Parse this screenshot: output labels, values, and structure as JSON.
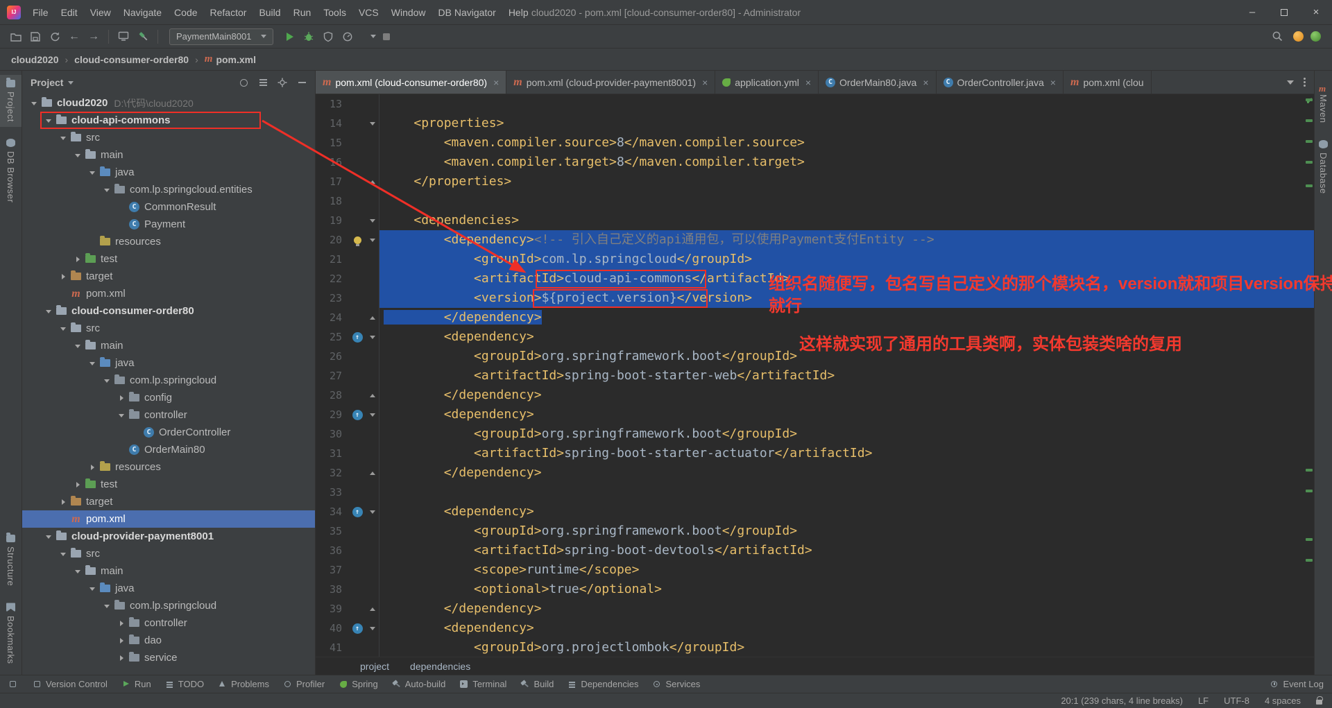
{
  "window": {
    "title": "cloud2020 - pom.xml [cloud-consumer-order80] - Administrator",
    "menus": [
      "File",
      "Edit",
      "View",
      "Navigate",
      "Code",
      "Refactor",
      "Build",
      "Run",
      "Tools",
      "VCS",
      "Window",
      "DB Navigator",
      "Help"
    ]
  },
  "toolbar": {
    "run_config": "PaymentMain8001"
  },
  "breadcrumbs": [
    "cloud2020",
    "cloud-consumer-order80",
    "pom.xml"
  ],
  "left_strip": {
    "top": [
      "Project",
      "DB Browser"
    ],
    "bottom": [
      "Structure",
      "Bookmarks"
    ]
  },
  "right_strip": [
    "Maven",
    "Database"
  ],
  "project_panel": {
    "title": "Project",
    "tree": [
      {
        "label": "cloud2020",
        "sub": "D:\\代码\\cloud2020",
        "level": 0,
        "icon": "module",
        "arrow": "v",
        "bold": true
      },
      {
        "label": "cloud-api-commons",
        "level": 1,
        "icon": "module",
        "arrow": "v",
        "bold": true,
        "boxed": true
      },
      {
        "label": "src",
        "level": 2,
        "icon": "folder",
        "arrow": "v"
      },
      {
        "label": "main",
        "level": 3,
        "icon": "folder",
        "arrow": "v"
      },
      {
        "label": "java",
        "level": 4,
        "icon": "java",
        "arrow": "v"
      },
      {
        "label": "com.lp.springcloud.entities",
        "level": 5,
        "icon": "package",
        "arrow": "v"
      },
      {
        "label": "CommonResult",
        "level": 6,
        "icon": "class",
        "arrow": "none"
      },
      {
        "label": "Payment",
        "level": 6,
        "icon": "class",
        "arrow": "none"
      },
      {
        "label": "resources",
        "level": 4,
        "icon": "resources",
        "arrow": "none"
      },
      {
        "label": "test",
        "level": 3,
        "icon": "test",
        "arrow": ">"
      },
      {
        "label": "target",
        "level": 2,
        "icon": "target",
        "arrow": ">"
      },
      {
        "label": "pom.xml",
        "level": 2,
        "icon": "maven",
        "arrow": "none"
      },
      {
        "label": "cloud-consumer-order80",
        "level": 1,
        "icon": "module",
        "arrow": "v",
        "bold": true
      },
      {
        "label": "src",
        "level": 2,
        "icon": "folder",
        "arrow": "v"
      },
      {
        "label": "main",
        "level": 3,
        "icon": "folder",
        "arrow": "v"
      },
      {
        "label": "java",
        "level": 4,
        "icon": "java",
        "arrow": "v"
      },
      {
        "label": "com.lp.springcloud",
        "level": 5,
        "icon": "package",
        "arrow": "v"
      },
      {
        "label": "config",
        "level": 6,
        "icon": "package",
        "arrow": ">"
      },
      {
        "label": "controller",
        "level": 6,
        "icon": "package",
        "arrow": "v"
      },
      {
        "label": "OrderController",
        "level": 7,
        "icon": "class",
        "arrow": "none"
      },
      {
        "label": "OrderMain80",
        "level": 6,
        "icon": "class",
        "arrow": "none"
      },
      {
        "label": "resources",
        "level": 4,
        "icon": "resources",
        "arrow": ">"
      },
      {
        "label": "test",
        "level": 3,
        "icon": "test",
        "arrow": ">"
      },
      {
        "label": "target",
        "level": 2,
        "icon": "target",
        "arrow": ">"
      },
      {
        "label": "pom.xml",
        "level": 2,
        "icon": "maven",
        "arrow": "none",
        "selected": true
      },
      {
        "label": "cloud-provider-payment8001",
        "level": 1,
        "icon": "module",
        "arrow": "v",
        "bold": true
      },
      {
        "label": "src",
        "level": 2,
        "icon": "folder",
        "arrow": "v"
      },
      {
        "label": "main",
        "level": 3,
        "icon": "folder",
        "arrow": "v"
      },
      {
        "label": "java",
        "level": 4,
        "icon": "java",
        "arrow": "v"
      },
      {
        "label": "com.lp.springcloud",
        "level": 5,
        "icon": "package",
        "arrow": "v"
      },
      {
        "label": "controller",
        "level": 6,
        "icon": "package",
        "arrow": ">"
      },
      {
        "label": "dao",
        "level": 6,
        "icon": "package",
        "arrow": ">"
      },
      {
        "label": "service",
        "level": 6,
        "icon": "package",
        "arrow": ">"
      }
    ]
  },
  "editor": {
    "tabs": [
      {
        "icon": "maven",
        "label": "pom.xml (cloud-consumer-order80)",
        "active": true
      },
      {
        "icon": "maven",
        "label": "pom.xml (cloud-provider-payment8001)"
      },
      {
        "icon": "spring",
        "label": "application.yml"
      },
      {
        "icon": "class",
        "label": "OrderMain80.java"
      },
      {
        "icon": "class",
        "label": "OrderController.java"
      },
      {
        "icon": "maven",
        "label": "pom.xml (clou",
        "truncated": true
      }
    ],
    "breadcrumb": [
      "project",
      "dependencies"
    ],
    "stripe_marks": [
      6,
      36,
      66,
      96,
      130,
      540,
      570,
      640,
      670
    ],
    "lines": [
      {
        "n": 13,
        "segs": []
      },
      {
        "n": 14,
        "fold": "down",
        "segs": [
          {
            "c": "p",
            "t": "    "
          },
          {
            "c": "t",
            "t": "<properties>"
          }
        ]
      },
      {
        "n": 15,
        "segs": [
          {
            "c": "p",
            "t": "        "
          },
          {
            "c": "t",
            "t": "<maven.compiler.source>"
          },
          {
            "c": "v",
            "t": "8"
          },
          {
            "c": "t",
            "t": "</maven.compiler.source>"
          }
        ]
      },
      {
        "n": 16,
        "segs": [
          {
            "c": "p",
            "t": "        "
          },
          {
            "c": "t",
            "t": "<maven.compiler.target>"
          },
          {
            "c": "v",
            "t": "8"
          },
          {
            "c": "t",
            "t": "</maven.compiler.target>"
          }
        ]
      },
      {
        "n": 17,
        "fold": "up",
        "segs": [
          {
            "c": "p",
            "t": "    "
          },
          {
            "c": "t",
            "t": "</properties>"
          }
        ]
      },
      {
        "n": 18,
        "segs": []
      },
      {
        "n": 19,
        "fold": "down",
        "segs": [
          {
            "c": "p",
            "t": "    "
          },
          {
            "c": "t",
            "t": "<dependencies>"
          }
        ]
      },
      {
        "n": 20,
        "fold": "down",
        "icon": "bulb",
        "sel": "full",
        "segs": [
          {
            "c": "p",
            "t": "        "
          },
          {
            "c": "t",
            "t": "<dependency>"
          },
          {
            "c": "c",
            "t": "<!-- 引入自己定义的api通用包，可以使用Payment支付Entity -->"
          }
        ]
      },
      {
        "n": 21,
        "sel": "full",
        "segs": [
          {
            "c": "p",
            "t": "            "
          },
          {
            "c": "t",
            "t": "<groupId>"
          },
          {
            "c": "v",
            "t": "com.lp.springcloud"
          },
          {
            "c": "t",
            "t": "</groupId>"
          }
        ]
      },
      {
        "n": 22,
        "sel": "full",
        "segs": [
          {
            "c": "p",
            "t": "            "
          },
          {
            "c": "t",
            "t": "<artifactId>"
          },
          {
            "c": "v",
            "t": "cloud-api-commons"
          },
          {
            "c": "t",
            "t": "</artifactId>"
          }
        ]
      },
      {
        "n": 23,
        "sel": "full",
        "segs": [
          {
            "c": "p",
            "t": "            "
          },
          {
            "c": "t",
            "t": "<version>"
          },
          {
            "c": "v",
            "t": "${project.version}"
          },
          {
            "c": "t",
            "t": "</version>"
          }
        ]
      },
      {
        "n": 24,
        "fold": "up",
        "sel": "text",
        "segs": [
          {
            "c": "p",
            "t": "        "
          },
          {
            "c": "t",
            "t": "</dependency>"
          }
        ]
      },
      {
        "n": 25,
        "fold": "down",
        "icon": "mvn",
        "segs": [
          {
            "c": "p",
            "t": "        "
          },
          {
            "c": "t",
            "t": "<dependency>"
          }
        ]
      },
      {
        "n": 26,
        "segs": [
          {
            "c": "p",
            "t": "            "
          },
          {
            "c": "t",
            "t": "<groupId>"
          },
          {
            "c": "v",
            "t": "org.springframework.boot"
          },
          {
            "c": "t",
            "t": "</groupId>"
          }
        ]
      },
      {
        "n": 27,
        "segs": [
          {
            "c": "p",
            "t": "            "
          },
          {
            "c": "t",
            "t": "<artifactId>"
          },
          {
            "c": "v",
            "t": "spring-boot-starter-web"
          },
          {
            "c": "t",
            "t": "</artifactId>"
          }
        ]
      },
      {
        "n": 28,
        "fold": "up",
        "segs": [
          {
            "c": "p",
            "t": "        "
          },
          {
            "c": "t",
            "t": "</dependency>"
          }
        ]
      },
      {
        "n": 29,
        "fold": "down",
        "icon": "mvn",
        "segs": [
          {
            "c": "p",
            "t": "        "
          },
          {
            "c": "t",
            "t": "<dependency>"
          }
        ]
      },
      {
        "n": 30,
        "segs": [
          {
            "c": "p",
            "t": "            "
          },
          {
            "c": "t",
            "t": "<groupId>"
          },
          {
            "c": "v",
            "t": "org.springframework.boot"
          },
          {
            "c": "t",
            "t": "</groupId>"
          }
        ]
      },
      {
        "n": 31,
        "segs": [
          {
            "c": "p",
            "t": "            "
          },
          {
            "c": "t",
            "t": "<artifactId>"
          },
          {
            "c": "v",
            "t": "spring-boot-starter-actuator"
          },
          {
            "c": "t",
            "t": "</artifactId>"
          }
        ]
      },
      {
        "n": 32,
        "fold": "up",
        "segs": [
          {
            "c": "p",
            "t": "        "
          },
          {
            "c": "t",
            "t": "</dependency>"
          }
        ]
      },
      {
        "n": 33,
        "segs": []
      },
      {
        "n": 34,
        "fold": "down",
        "icon": "mvn",
        "segs": [
          {
            "c": "p",
            "t": "        "
          },
          {
            "c": "t",
            "t": "<dependency>"
          }
        ]
      },
      {
        "n": 35,
        "segs": [
          {
            "c": "p",
            "t": "            "
          },
          {
            "c": "t",
            "t": "<groupId>"
          },
          {
            "c": "v",
            "t": "org.springframework.boot"
          },
          {
            "c": "t",
            "t": "</groupId>"
          }
        ]
      },
      {
        "n": 36,
        "segs": [
          {
            "c": "p",
            "t": "            "
          },
          {
            "c": "t",
            "t": "<artifactId>"
          },
          {
            "c": "v",
            "t": "spring-boot-devtools"
          },
          {
            "c": "t",
            "t": "</artifactId>"
          }
        ]
      },
      {
        "n": 37,
        "segs": [
          {
            "c": "p",
            "t": "            "
          },
          {
            "c": "t",
            "t": "<scope>"
          },
          {
            "c": "v",
            "t": "runtime"
          },
          {
            "c": "t",
            "t": "</scope>"
          }
        ]
      },
      {
        "n": 38,
        "segs": [
          {
            "c": "p",
            "t": "            "
          },
          {
            "c": "t",
            "t": "<optional>"
          },
          {
            "c": "v",
            "t": "true"
          },
          {
            "c": "t",
            "t": "</optional>"
          }
        ]
      },
      {
        "n": 39,
        "fold": "up",
        "segs": [
          {
            "c": "p",
            "t": "        "
          },
          {
            "c": "t",
            "t": "</dependency>"
          }
        ]
      },
      {
        "n": 40,
        "fold": "down",
        "icon": "mvn",
        "segs": [
          {
            "c": "p",
            "t": "        "
          },
          {
            "c": "t",
            "t": "<dependency>"
          }
        ]
      },
      {
        "n": 41,
        "segs": [
          {
            "c": "p",
            "t": "            "
          },
          {
            "c": "t",
            "t": "<groupId>"
          },
          {
            "c": "v",
            "t": "org.projectlombok"
          },
          {
            "c": "t",
            "t": "</groupId>"
          }
        ]
      }
    ]
  },
  "annotations": {
    "note1_line1": "组织名随便写，包名写自己定义的那个模块名，version就和项目version保持一致",
    "note1_line2": "就行",
    "note2": "这样就实现了通用的工具类啊，实体包装类啥的复用"
  },
  "bottom_bar": {
    "left": [
      {
        "label": "Version Control",
        "icon": "vc"
      },
      {
        "label": "Run",
        "icon": "run"
      },
      {
        "label": "TODO",
        "icon": "todo"
      },
      {
        "label": "Problems",
        "icon": "problems"
      },
      {
        "label": "Profiler",
        "icon": "profiler"
      },
      {
        "label": "Spring",
        "icon": "spring"
      },
      {
        "label": "Auto-build",
        "icon": "autobuild"
      },
      {
        "label": "Terminal",
        "icon": "terminal"
      },
      {
        "label": "Build",
        "icon": "build"
      },
      {
        "label": "Dependencies",
        "icon": "dependencies"
      },
      {
        "label": "Services",
        "icon": "services"
      }
    ],
    "right": "Event Log"
  },
  "status_bar": {
    "position": "20:1 (239 chars, 4 line breaks)",
    "line_sep": "LF",
    "encoding": "UTF-8",
    "indent": "4 spaces"
  },
  "colors": {
    "editor_bg": "#2B2B2B",
    "panel_bg": "#3C3F41",
    "selection_blue": "#2151A5",
    "tree_selection": "#4B6EAF",
    "annotation_red": "#EF2F27",
    "xml_tag": "#E8BF6A",
    "xml_text": "#A9B7C6"
  }
}
